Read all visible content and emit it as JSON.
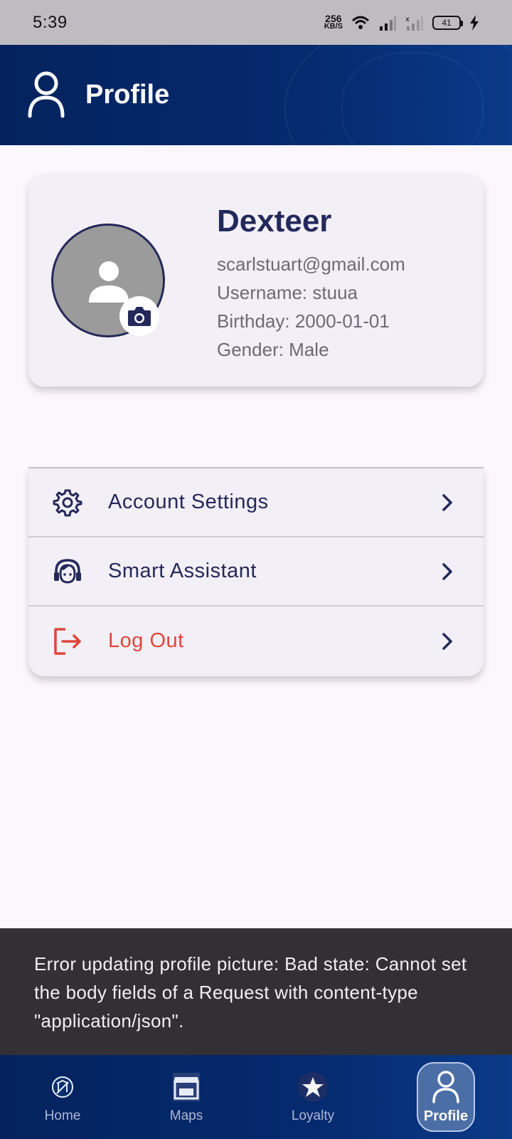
{
  "status_bar": {
    "time": "5:39",
    "net_speed_value": "256",
    "net_speed_unit": "KB/S",
    "battery": "41"
  },
  "header": {
    "title": "Profile"
  },
  "profile": {
    "name": "Dexteer",
    "email": "scarlstuart@gmail.com",
    "username": "Username: stuua",
    "birthday": "Birthday: 2000-01-01",
    "gender": "Gender: Male"
  },
  "menu": {
    "items": [
      {
        "label": "Account Settings",
        "icon": "gear-icon"
      },
      {
        "label": "Smart Assistant",
        "icon": "headset-icon"
      },
      {
        "label": "Log Out",
        "icon": "logout-icon"
      }
    ]
  },
  "snackbar": {
    "message": "Error updating profile picture: Bad state: Cannot set the body fields of a Request with content-type \"application/json\"."
  },
  "bottom_nav": {
    "items": [
      {
        "label": "Home",
        "icon": "home-icon"
      },
      {
        "label": "Maps",
        "icon": "store-icon"
      },
      {
        "label": "Loyalty",
        "icon": "star-icon"
      },
      {
        "label": "Profile",
        "icon": "person-icon",
        "active": true
      }
    ]
  },
  "colors": {
    "primary": "#23295b",
    "header_bg": "#052a6e",
    "danger": "#e0453a",
    "snackbar_bg": "#323034"
  }
}
